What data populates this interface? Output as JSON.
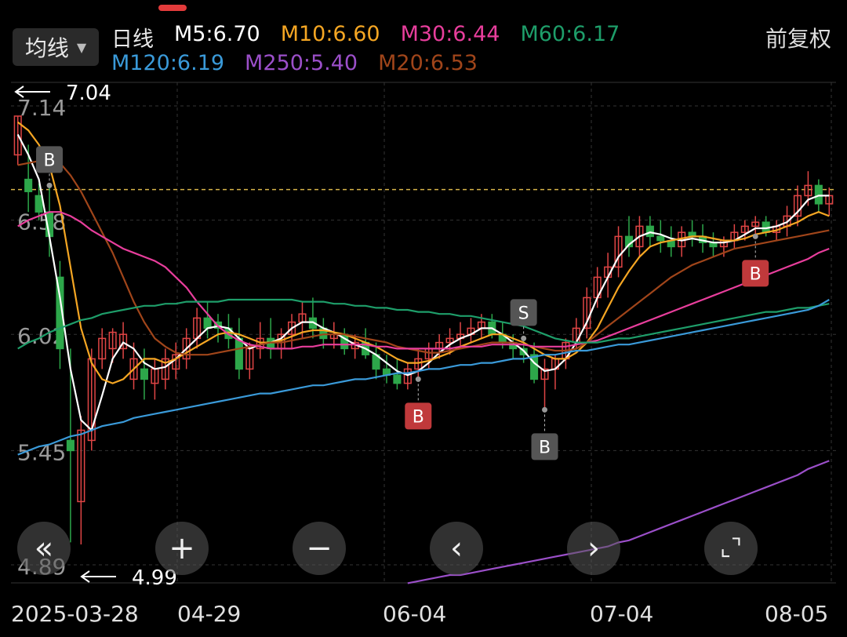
{
  "header": {
    "ma_dropdown_label": "均线",
    "period_label": "日线",
    "adjust_label": "前复权",
    "ma_legend": [
      {
        "text": "M5:6.70",
        "color": "#ffffff"
      },
      {
        "text": "M10:6.60",
        "color": "#f5a623"
      },
      {
        "text": "M30:6.44",
        "color": "#e83e9c"
      },
      {
        "text": "M60:6.17",
        "color": "#1e9e6a"
      },
      {
        "text": "M120:6.19",
        "color": "#3a9ad9"
      },
      {
        "text": "M250:5.40",
        "color": "#9b4fc9"
      },
      {
        "text": "M20:6.53",
        "color": "#a0451a"
      }
    ]
  },
  "colors": {
    "up": "#e04545",
    "down": "#2da74a",
    "grid": "#333333",
    "ref_line": "#d8b44a"
  },
  "chart_data": {
    "type": "candlestick",
    "y_axis_labels": [
      "7.14",
      "6.58",
      "6.02",
      "5.45",
      "4.89"
    ],
    "y_range": [
      4.89,
      7.14
    ],
    "x_labels": [
      "2025-03-28",
      "04-29",
      "06-04",
      "07-04",
      "08-05"
    ],
    "high_marker": "7.04",
    "low_marker": "4.99",
    "reference_price": 6.73,
    "candles": [
      [
        6.9,
        7.09,
        6.85,
        7.09
      ],
      [
        6.78,
        6.95,
        6.62,
        6.72
      ],
      [
        6.7,
        6.76,
        6.58,
        6.62
      ],
      [
        6.62,
        6.75,
        6.4,
        6.5
      ],
      [
        6.3,
        6.38,
        5.85,
        5.95
      ],
      [
        5.5,
        5.95,
        5.0,
        5.45
      ],
      [
        5.2,
        5.62,
        4.99,
        5.55
      ],
      [
        5.5,
        5.95,
        5.45,
        5.9
      ],
      [
        5.9,
        6.05,
        5.85,
        6.0
      ],
      [
        5.95,
        6.05,
        5.88,
        6.03
      ],
      [
        5.95,
        6.08,
        5.9,
        6.02
      ],
      [
        5.8,
        5.98,
        5.75,
        5.9
      ],
      [
        5.85,
        5.95,
        5.7,
        5.8
      ],
      [
        5.78,
        5.9,
        5.7,
        5.85
      ],
      [
        5.8,
        5.95,
        5.75,
        5.9
      ],
      [
        5.85,
        5.98,
        5.8,
        5.92
      ],
      [
        5.9,
        6.05,
        5.85,
        6.0
      ],
      [
        6.0,
        6.15,
        5.95,
        6.1
      ],
      [
        6.1,
        6.18,
        6.0,
        6.05
      ],
      [
        6.08,
        6.12,
        5.98,
        6.05
      ],
      [
        6.05,
        6.12,
        5.95,
        6.0
      ],
      [
        6.0,
        6.1,
        5.8,
        5.85
      ],
      [
        5.85,
        5.98,
        5.8,
        5.95
      ],
      [
        5.95,
        6.08,
        5.9,
        6.0
      ],
      [
        6.0,
        6.1,
        5.9,
        5.95
      ],
      [
        5.95,
        6.05,
        5.9,
        6.02
      ],
      [
        6.02,
        6.12,
        5.95,
        6.08
      ],
      [
        6.08,
        6.18,
        6.0,
        6.12
      ],
      [
        6.1,
        6.2,
        6.0,
        6.05
      ],
      [
        6.05,
        6.1,
        5.95,
        6.0
      ],
      [
        6.0,
        6.08,
        5.95,
        6.02
      ],
      [
        6.02,
        6.05,
        5.92,
        5.95
      ],
      [
        5.95,
        6.02,
        5.9,
        5.98
      ],
      [
        5.98,
        6.05,
        5.9,
        5.92
      ],
      [
        5.92,
        5.98,
        5.8,
        5.85
      ],
      [
        5.85,
        5.92,
        5.78,
        5.82
      ],
      [
        5.82,
        5.9,
        5.75,
        5.78
      ],
      [
        5.78,
        5.88,
        5.75,
        5.85
      ],
      [
        5.85,
        5.95,
        5.8,
        5.9
      ],
      [
        5.9,
        5.98,
        5.85,
        5.95
      ],
      [
        5.95,
        6.02,
        5.9,
        5.98
      ],
      [
        5.98,
        6.05,
        5.92,
        6.0
      ],
      [
        6.0,
        6.08,
        5.95,
        6.02
      ],
      [
        6.02,
        6.1,
        5.98,
        6.05
      ],
      [
        6.05,
        6.12,
        6.0,
        6.08
      ],
      [
        6.08,
        6.12,
        6.0,
        6.02
      ],
      [
        6.02,
        6.08,
        5.95,
        5.98
      ],
      [
        5.98,
        6.02,
        5.9,
        5.95
      ],
      [
        5.95,
        6.0,
        5.88,
        5.92
      ],
      [
        5.92,
        5.98,
        5.78,
        5.8
      ],
      [
        5.8,
        5.9,
        5.65,
        5.85
      ],
      [
        5.85,
        5.92,
        5.75,
        5.9
      ],
      [
        5.9,
        6.0,
        5.85,
        5.98
      ],
      [
        5.98,
        6.1,
        5.95,
        6.05
      ],
      [
        6.05,
        6.25,
        6.0,
        6.2
      ],
      [
        6.2,
        6.35,
        6.15,
        6.3
      ],
      [
        6.3,
        6.42,
        6.2,
        6.35
      ],
      [
        6.35,
        6.55,
        6.3,
        6.5
      ],
      [
        6.5,
        6.6,
        6.4,
        6.45
      ],
      [
        6.45,
        6.6,
        6.4,
        6.55
      ],
      [
        6.55,
        6.6,
        6.45,
        6.5
      ],
      [
        6.5,
        6.58,
        6.42,
        6.48
      ],
      [
        6.48,
        6.55,
        6.4,
        6.45
      ],
      [
        6.45,
        6.55,
        6.4,
        6.52
      ],
      [
        6.52,
        6.58,
        6.45,
        6.5
      ],
      [
        6.5,
        6.56,
        6.42,
        6.47
      ],
      [
        6.47,
        6.52,
        6.4,
        6.45
      ],
      [
        6.45,
        6.5,
        6.4,
        6.48
      ],
      [
        6.48,
        6.56,
        6.44,
        6.52
      ],
      [
        6.52,
        6.58,
        6.48,
        6.55
      ],
      [
        6.55,
        6.6,
        6.5,
        6.57
      ],
      [
        6.57,
        6.6,
        6.5,
        6.52
      ],
      [
        6.52,
        6.58,
        6.48,
        6.55
      ],
      [
        6.55,
        6.65,
        6.5,
        6.6
      ],
      [
        6.6,
        6.75,
        6.55,
        6.7
      ],
      [
        6.7,
        6.82,
        6.65,
        6.75
      ],
      [
        6.75,
        6.78,
        6.62,
        6.66
      ],
      [
        6.66,
        6.74,
        6.6,
        6.7
      ]
    ],
    "ma_lines": [
      {
        "name": "M5",
        "color": "#ffffff",
        "values": [
          7.0,
          6.9,
          6.78,
          6.5,
          6.2,
          5.85,
          5.6,
          5.55,
          5.72,
          5.9,
          5.98,
          5.95,
          5.88,
          5.85,
          5.86,
          5.9,
          5.95,
          6.0,
          6.05,
          6.06,
          6.05,
          6.0,
          5.95,
          5.97,
          5.98,
          6.0,
          6.05,
          6.08,
          6.08,
          6.05,
          6.03,
          6.0,
          5.97,
          5.95,
          5.92,
          5.88,
          5.84,
          5.82,
          5.84,
          5.88,
          5.93,
          5.97,
          6.0,
          6.02,
          6.05,
          6.05,
          6.02,
          5.98,
          5.94,
          5.88,
          5.84,
          5.85,
          5.9,
          5.98,
          6.08,
          6.2,
          6.3,
          6.4,
          6.46,
          6.5,
          6.52,
          6.51,
          6.49,
          6.48,
          6.49,
          6.48,
          6.47,
          6.47,
          6.48,
          6.51,
          6.54,
          6.54,
          6.55,
          6.57,
          6.62,
          6.68,
          6.7,
          6.7
        ]
      },
      {
        "name": "M10",
        "color": "#f5a623",
        "values": [
          7.06,
          7.02,
          6.95,
          6.85,
          6.65,
          6.35,
          6.05,
          5.88,
          5.8,
          5.78,
          5.8,
          5.85,
          5.9,
          5.9,
          5.88,
          5.9,
          5.93,
          5.96,
          5.99,
          6.02,
          6.03,
          6.02,
          6.0,
          5.98,
          5.98,
          5.99,
          6.01,
          6.03,
          6.04,
          6.04,
          6.03,
          6.02,
          6.0,
          5.98,
          5.96,
          5.93,
          5.9,
          5.88,
          5.88,
          5.89,
          5.91,
          5.93,
          5.96,
          5.98,
          6.0,
          6.02,
          6.02,
          6.0,
          5.98,
          5.95,
          5.92,
          5.9,
          5.9,
          5.93,
          5.98,
          6.05,
          6.15,
          6.25,
          6.33,
          6.4,
          6.45,
          6.47,
          6.48,
          6.49,
          6.5,
          6.5,
          6.49,
          6.48,
          6.48,
          6.49,
          6.51,
          6.52,
          6.53,
          6.55,
          6.57,
          6.6,
          6.62,
          6.6
        ]
      },
      {
        "name": "M20",
        "color": "#a0451a",
        "values": [
          6.85,
          6.86,
          6.87,
          6.88,
          6.86,
          6.8,
          6.72,
          6.62,
          6.52,
          6.42,
          6.3,
          6.18,
          6.08,
          6.0,
          5.96,
          5.93,
          5.92,
          5.92,
          5.92,
          5.93,
          5.94,
          5.95,
          5.96,
          5.97,
          5.98,
          5.98,
          5.99,
          6.0,
          6.01,
          6.02,
          6.02,
          6.02,
          6.01,
          6.0,
          5.99,
          5.98,
          5.96,
          5.95,
          5.94,
          5.93,
          5.93,
          5.94,
          5.95,
          5.96,
          5.97,
          5.98,
          5.98,
          5.98,
          5.97,
          5.96,
          5.95,
          5.94,
          5.94,
          5.95,
          5.98,
          6.02,
          6.06,
          6.1,
          6.14,
          6.18,
          6.22,
          6.26,
          6.3,
          6.33,
          6.36,
          6.38,
          6.4,
          6.42,
          6.44,
          6.45,
          6.46,
          6.47,
          6.48,
          6.49,
          6.5,
          6.51,
          6.52,
          6.53
        ]
      },
      {
        "name": "M30",
        "color": "#e83e9c",
        "values": [
          6.55,
          6.58,
          6.6,
          6.62,
          6.62,
          6.6,
          6.57,
          6.53,
          6.5,
          6.47,
          6.44,
          6.42,
          6.4,
          6.38,
          6.35,
          6.3,
          6.25,
          6.18,
          6.12,
          6.06,
          6.02,
          5.99,
          5.97,
          5.96,
          5.95,
          5.95,
          5.95,
          5.96,
          5.96,
          5.97,
          5.97,
          5.97,
          5.97,
          5.97,
          5.96,
          5.96,
          5.95,
          5.95,
          5.95,
          5.95,
          5.95,
          5.95,
          5.96,
          5.96,
          5.96,
          5.97,
          5.97,
          5.97,
          5.97,
          5.96,
          5.96,
          5.96,
          5.96,
          5.97,
          5.98,
          5.99,
          6.01,
          6.03,
          6.05,
          6.07,
          6.09,
          6.11,
          6.13,
          6.15,
          6.17,
          6.19,
          6.21,
          6.23,
          6.25,
          6.27,
          6.29,
          6.31,
          6.33,
          6.35,
          6.37,
          6.39,
          6.42,
          6.44
        ]
      },
      {
        "name": "M60",
        "color": "#1e9e6a",
        "values": [
          5.95,
          5.98,
          6.0,
          6.03,
          6.05,
          6.07,
          6.09,
          6.1,
          6.12,
          6.13,
          6.14,
          6.15,
          6.16,
          6.16,
          6.17,
          6.17,
          6.18,
          6.18,
          6.18,
          6.18,
          6.19,
          6.19,
          6.19,
          6.19,
          6.19,
          6.19,
          6.19,
          6.18,
          6.18,
          6.18,
          6.17,
          6.17,
          6.16,
          6.16,
          6.15,
          6.15,
          6.14,
          6.14,
          6.13,
          6.13,
          6.12,
          6.12,
          6.11,
          6.11,
          6.1,
          6.09,
          6.08,
          6.07,
          6.06,
          6.04,
          6.02,
          6.0,
          5.99,
          5.98,
          5.98,
          5.98,
          5.99,
          6.0,
          6.0,
          6.01,
          6.02,
          6.03,
          6.04,
          6.05,
          6.06,
          6.07,
          6.08,
          6.09,
          6.1,
          6.11,
          6.12,
          6.13,
          6.13,
          6.14,
          6.15,
          6.15,
          6.16,
          6.17
        ]
      },
      {
        "name": "M120",
        "color": "#3a9ad9",
        "values": [
          5.43,
          5.45,
          5.47,
          5.48,
          5.5,
          5.52,
          5.53,
          5.55,
          5.57,
          5.58,
          5.59,
          5.61,
          5.62,
          5.63,
          5.64,
          5.65,
          5.66,
          5.67,
          5.68,
          5.69,
          5.7,
          5.71,
          5.72,
          5.73,
          5.73,
          5.74,
          5.75,
          5.76,
          5.77,
          5.77,
          5.78,
          5.79,
          5.8,
          5.8,
          5.81,
          5.82,
          5.83,
          5.83,
          5.84,
          5.85,
          5.85,
          5.86,
          5.87,
          5.87,
          5.88,
          5.88,
          5.89,
          5.9,
          5.9,
          5.91,
          5.92,
          5.92,
          5.93,
          5.94,
          5.94,
          5.95,
          5.96,
          5.97,
          5.97,
          5.98,
          5.99,
          6.0,
          6.01,
          6.02,
          6.03,
          6.04,
          6.05,
          6.06,
          6.07,
          6.08,
          6.09,
          6.1,
          6.11,
          6.12,
          6.13,
          6.14,
          6.16,
          6.19
        ]
      },
      {
        "name": "M250",
        "color": "#9b4fc9",
        "values": [
          4.8,
          4.81,
          4.82,
          4.83,
          4.84,
          4.84,
          4.85,
          4.86,
          4.87,
          4.88,
          4.89,
          4.9,
          4.91,
          4.92,
          4.93,
          4.94,
          4.95,
          4.96,
          4.97,
          4.98,
          5.0,
          5.01,
          5.03,
          5.05,
          5.07,
          5.09,
          5.11,
          5.13,
          5.15,
          5.17,
          5.19,
          5.21,
          5.23,
          5.25,
          5.27,
          5.29,
          5.31,
          5.33,
          5.36,
          5.38,
          5.4
        ]
      }
    ],
    "markers": [
      {
        "label": "B",
        "candle": 3,
        "bg": "#555555",
        "pos": "above"
      },
      {
        "label": "S",
        "candle": 48,
        "bg": "#555555",
        "pos": "above"
      },
      {
        "label": "B",
        "candle": 38,
        "bg": "#c0393b",
        "pos": "below"
      },
      {
        "label": "B",
        "candle": 50,
        "bg": "#555555",
        "pos": "below"
      },
      {
        "label": "B",
        "candle": 70,
        "bg": "#c0393b",
        "pos": "below"
      }
    ]
  },
  "controls": {
    "rewind_icon": "«",
    "zoom_in_icon": "+",
    "zoom_out_icon": "−",
    "prev_icon": "‹",
    "next_icon": "›",
    "fullscreen_icon": "⌞⌝"
  }
}
